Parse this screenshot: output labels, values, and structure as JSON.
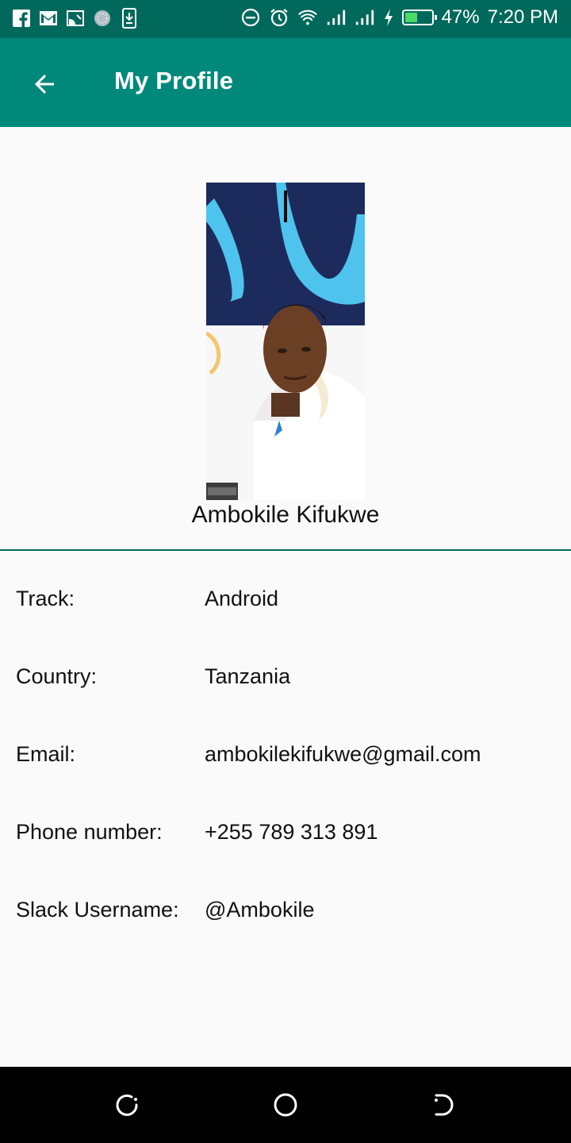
{
  "status_bar": {
    "battery_percent_text": "47%",
    "battery_level": 0.47,
    "time": "7:20 PM",
    "left_icons": [
      "facebook-icon",
      "gmail-icon",
      "cast-icon",
      "sync-icon",
      "download-icon"
    ],
    "right_icons": [
      "do-not-disturb-icon",
      "alarm-icon",
      "wifi-icon",
      "signal-icon",
      "signal-icon",
      "charging-icon",
      "battery-icon"
    ],
    "background": "#00695c",
    "battery_fill_color": "#4cd964"
  },
  "app_bar": {
    "title": "My Profile",
    "back_icon": "arrow-back-icon",
    "background": "#00897b"
  },
  "profile": {
    "name": "Ambokile Kifukwe"
  },
  "details": [
    {
      "label": "Track:",
      "value": "Android"
    },
    {
      "label": "Country:",
      "value": "Tanzania"
    },
    {
      "label": "Email:",
      "value": "ambokilekifukwe@gmail.com"
    },
    {
      "label": "Phone number:",
      "value": "+255 789 313 891"
    },
    {
      "label": "Slack Username:",
      "value": "@Ambokile"
    }
  ],
  "nav_bar": {
    "buttons": [
      "recents-icon",
      "home-icon",
      "back-icon"
    ]
  }
}
